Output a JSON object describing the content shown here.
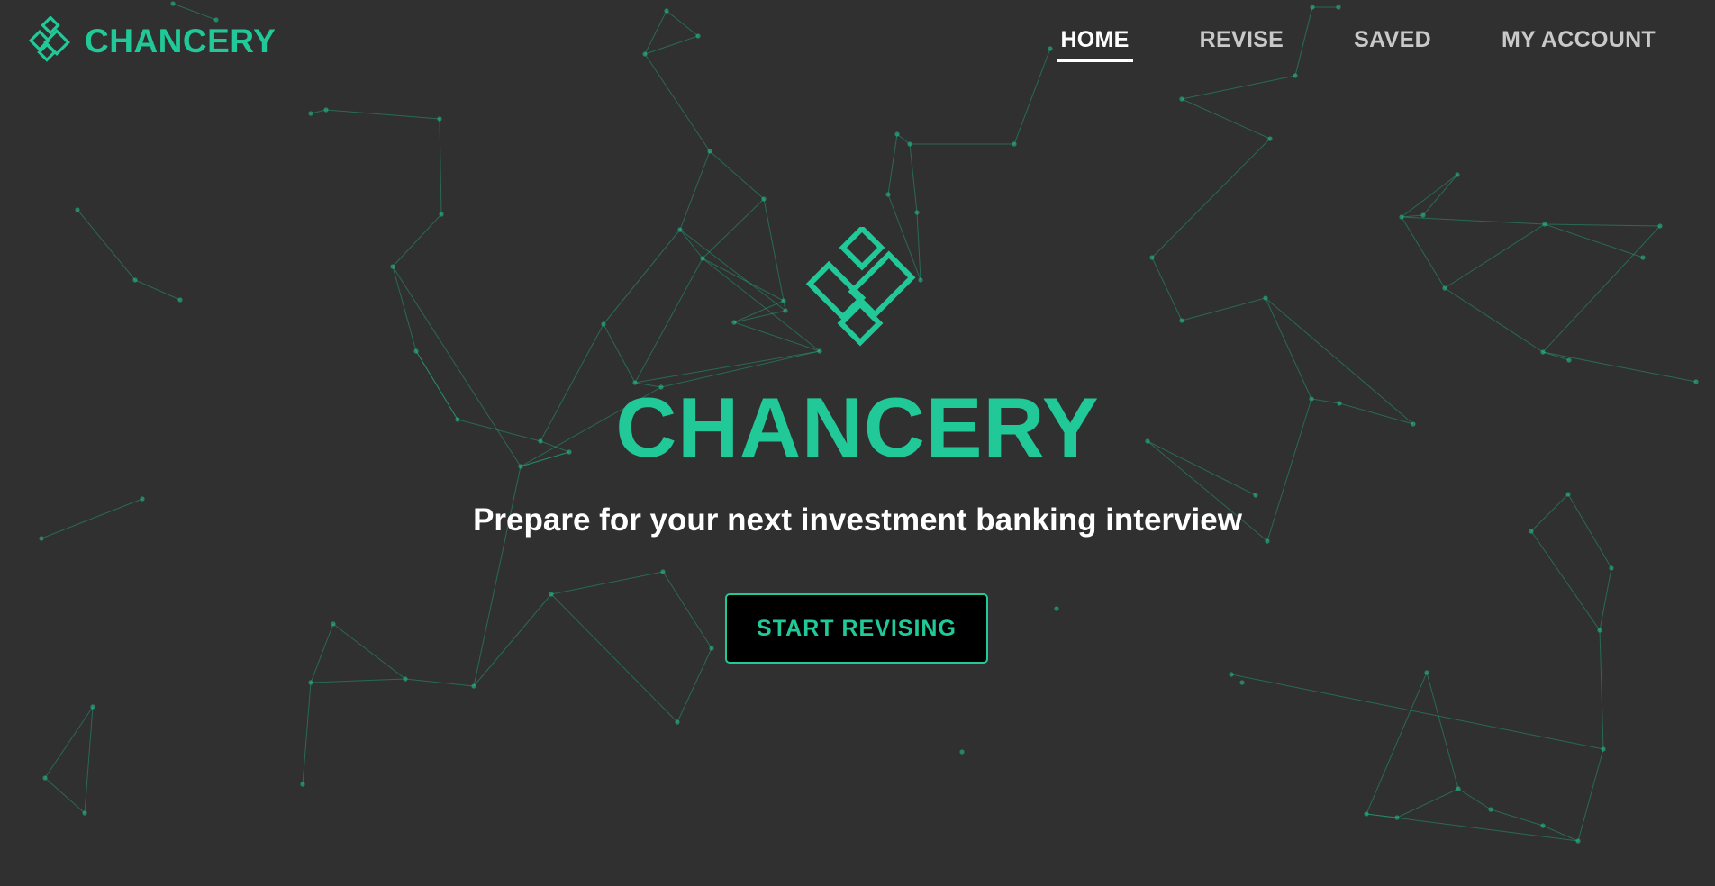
{
  "brand": {
    "name": "CHANCERY",
    "logo_icon": "chancery-diamond-logo-icon",
    "accent_color": "#20c997"
  },
  "nav": {
    "items": [
      {
        "label": "HOME",
        "active": true
      },
      {
        "label": "REVISE",
        "active": false
      },
      {
        "label": "SAVED",
        "active": false
      },
      {
        "label": "MY ACCOUNT",
        "active": false
      }
    ]
  },
  "hero": {
    "logo_icon": "chancery-diamond-logo-icon",
    "title": "CHANCERY",
    "subtitle": "Prepare for your next investment banking interview",
    "cta_label": "START REVISING"
  },
  "background": {
    "color": "#303030",
    "pattern": "particle-network"
  }
}
